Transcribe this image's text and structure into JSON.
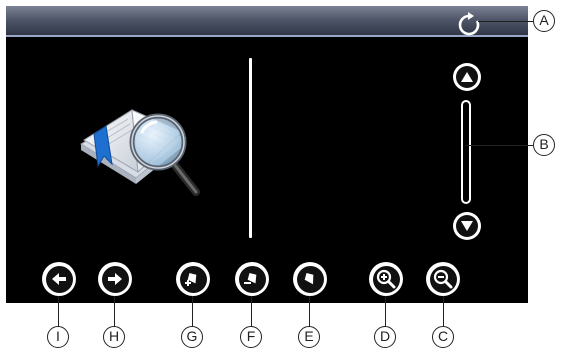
{
  "toolbar_buttons": [
    {
      "icon": "arrow-left-icon"
    },
    {
      "icon": "arrow-right-icon"
    },
    {
      "icon": "bookmark-add-icon"
    },
    {
      "icon": "bookmark-remove-icon"
    },
    {
      "icon": "bookmark-icon"
    },
    {
      "icon": "zoom-in-icon"
    },
    {
      "icon": "zoom-out-icon"
    }
  ],
  "scrollbar": {
    "up_icon": "triangle-up-icon",
    "down_icon": "triangle-down-icon"
  },
  "refresh_icon": "refresh-icon",
  "illustration": "book-magnifier-icon",
  "callouts": {
    "A": "A",
    "B": "B",
    "C": "C",
    "D": "D",
    "E": "E",
    "F": "F",
    "G": "G",
    "H": "H",
    "I": "I"
  },
  "colors": {
    "screen_bg": "#000000",
    "titlebar": "#4f5669",
    "button_ring": "#ffffff"
  }
}
